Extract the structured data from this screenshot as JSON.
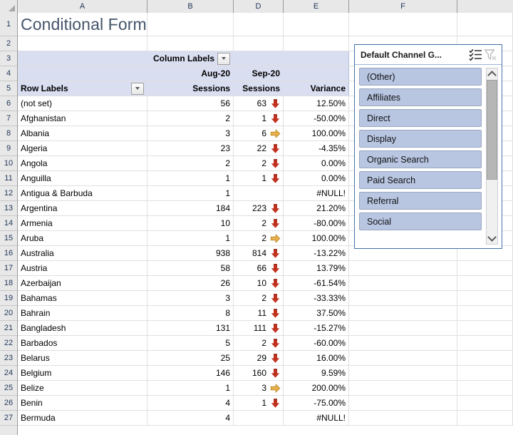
{
  "spreadsheet": {
    "column_headers": [
      "A",
      "B",
      "D",
      "E",
      "F"
    ],
    "title": "Conditional Formatting",
    "pivot": {
      "column_labels": "Column Labels",
      "row_labels": "Row Labels",
      "period_1": "Aug-20",
      "period_2": "Sep-20",
      "measure_1": "Sessions",
      "measure_2": "Sessions",
      "measure_3": "Variance"
    },
    "rows": [
      {
        "num": "6",
        "country": "(not set)",
        "aug": "56",
        "sep": "63",
        "variance": "12.50%",
        "icon": "red-down-arrow"
      },
      {
        "num": "7",
        "country": "Afghanistan",
        "aug": "2",
        "sep": "1",
        "variance": "-50.00%",
        "icon": "red-down-arrow"
      },
      {
        "num": "8",
        "country": "Albania",
        "aug": "3",
        "sep": "6",
        "variance": "100.00%",
        "icon": "amber-right-arrow"
      },
      {
        "num": "9",
        "country": "Algeria",
        "aug": "23",
        "sep": "22",
        "variance": "-4.35%",
        "icon": "red-down-arrow"
      },
      {
        "num": "10",
        "country": "Angola",
        "aug": "2",
        "sep": "2",
        "variance": "0.00%",
        "icon": "red-down-arrow"
      },
      {
        "num": "11",
        "country": "Anguilla",
        "aug": "1",
        "sep": "1",
        "variance": "0.00%",
        "icon": "red-down-arrow"
      },
      {
        "num": "12",
        "country": "Antigua & Barbuda",
        "aug": "1",
        "sep": "",
        "variance": "#NULL!",
        "icon": "none"
      },
      {
        "num": "13",
        "country": "Argentina",
        "aug": "184",
        "sep": "223",
        "variance": "21.20%",
        "icon": "red-down-arrow"
      },
      {
        "num": "14",
        "country": "Armenia",
        "aug": "10",
        "sep": "2",
        "variance": "-80.00%",
        "icon": "red-down-arrow"
      },
      {
        "num": "15",
        "country": "Aruba",
        "aug": "1",
        "sep": "2",
        "variance": "100.00%",
        "icon": "amber-right-arrow"
      },
      {
        "num": "16",
        "country": "Australia",
        "aug": "938",
        "sep": "814",
        "variance": "-13.22%",
        "icon": "red-down-arrow"
      },
      {
        "num": "17",
        "country": "Austria",
        "aug": "58",
        "sep": "66",
        "variance": "13.79%",
        "icon": "red-down-arrow"
      },
      {
        "num": "18",
        "country": "Azerbaijan",
        "aug": "26",
        "sep": "10",
        "variance": "-61.54%",
        "icon": "red-down-arrow"
      },
      {
        "num": "19",
        "country": "Bahamas",
        "aug": "3",
        "sep": "2",
        "variance": "-33.33%",
        "icon": "red-down-arrow"
      },
      {
        "num": "20",
        "country": "Bahrain",
        "aug": "8",
        "sep": "11",
        "variance": "37.50%",
        "icon": "red-down-arrow"
      },
      {
        "num": "21",
        "country": "Bangladesh",
        "aug": "131",
        "sep": "111",
        "variance": "-15.27%",
        "icon": "red-down-arrow"
      },
      {
        "num": "22",
        "country": "Barbados",
        "aug": "5",
        "sep": "2",
        "variance": "-60.00%",
        "icon": "red-down-arrow"
      },
      {
        "num": "23",
        "country": "Belarus",
        "aug": "25",
        "sep": "29",
        "variance": "16.00%",
        "icon": "red-down-arrow"
      },
      {
        "num": "24",
        "country": "Belgium",
        "aug": "146",
        "sep": "160",
        "variance": "9.59%",
        "icon": "red-down-arrow"
      },
      {
        "num": "25",
        "country": "Belize",
        "aug": "1",
        "sep": "3",
        "variance": "200.00%",
        "icon": "amber-right-arrow"
      },
      {
        "num": "26",
        "country": "Benin",
        "aug": "4",
        "sep": "1",
        "variance": "-75.00%",
        "icon": "red-down-arrow"
      },
      {
        "num": "27",
        "country": "Bermuda",
        "aug": "4",
        "sep": "",
        "variance": "#NULL!",
        "icon": "none"
      }
    ]
  },
  "slicer": {
    "title": "Default Channel G...",
    "multiselect_icon": "multi-select-icon",
    "clear_filter_icon": "clear-filter-icon",
    "items": [
      {
        "label": "(Other)",
        "selected": true
      },
      {
        "label": "Affiliates",
        "selected": true
      },
      {
        "label": "Direct",
        "selected": true
      },
      {
        "label": "Display",
        "selected": true
      },
      {
        "label": "Organic Search",
        "selected": true
      },
      {
        "label": "Paid Search",
        "selected": true
      },
      {
        "label": "Referral",
        "selected": true
      },
      {
        "label": "Social",
        "selected": true
      }
    ],
    "scroll_up_icon": "chevron-up-icon",
    "scroll_down_icon": "chevron-down-icon"
  },
  "colors": {
    "title_text": "#44546a",
    "pivot_header_fill": "#d9def0",
    "slicer_item_fill": "#b8c6e2",
    "slicer_border": "#4472a8",
    "icon_red": "#c0321f",
    "icon_amber": "#e8b14c"
  }
}
